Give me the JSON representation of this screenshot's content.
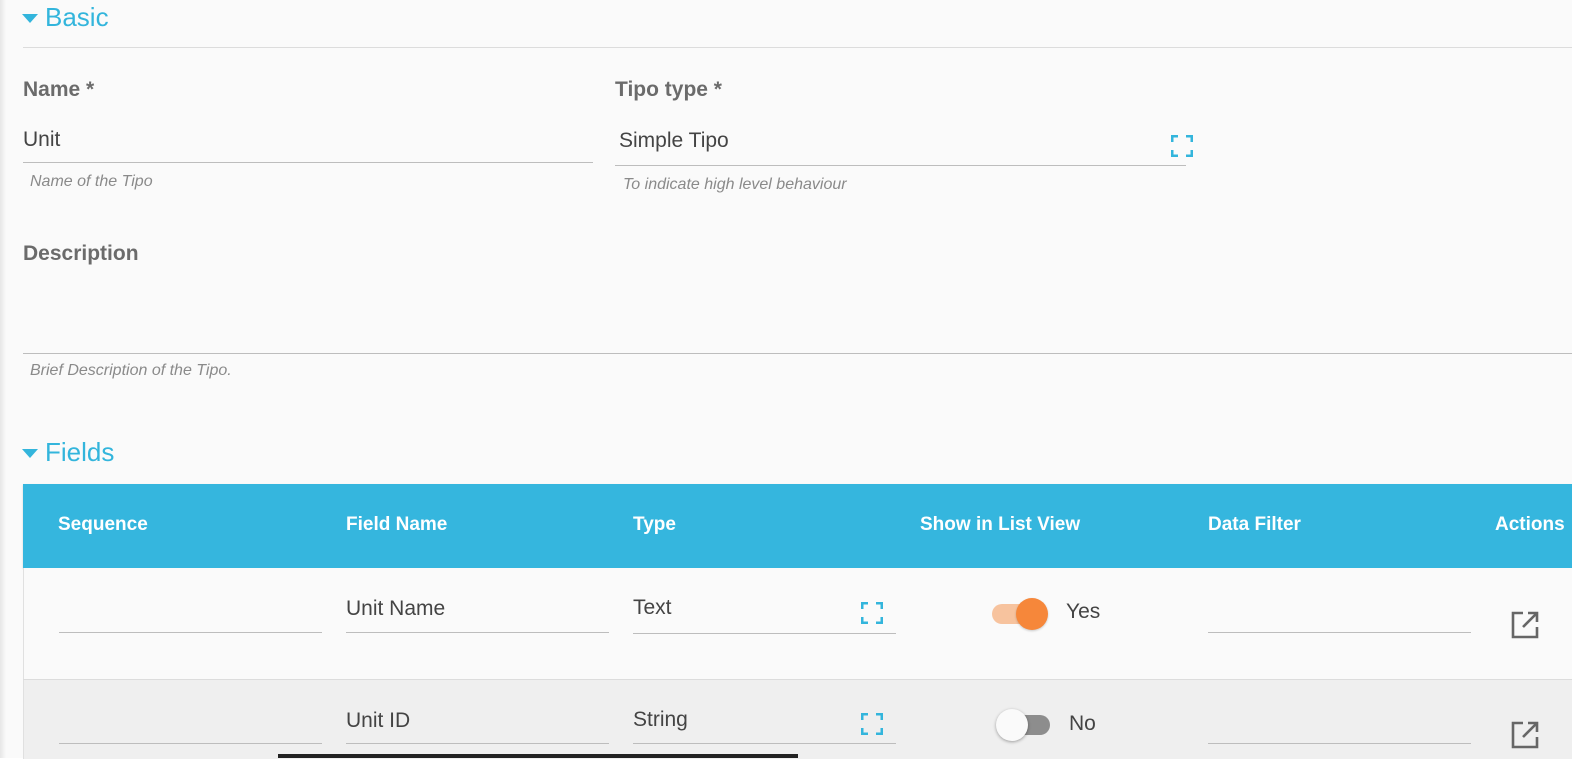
{
  "basic": {
    "section_title": "Basic",
    "name_label": "Name *",
    "name_value": "Unit",
    "name_hint": "Name of the Tipo",
    "tipo_type_label": "Tipo type *",
    "tipo_type_value": "Simple Tipo",
    "tipo_type_hint": "To indicate high level behaviour",
    "description_label": "Description",
    "description_value": "",
    "description_hint": "Brief Description of the Tipo."
  },
  "fields": {
    "section_title": "Fields",
    "columns": [
      "Sequence",
      "Field Name",
      "Type",
      "Show in List View",
      "Data Filter",
      "Actions"
    ],
    "rows": [
      {
        "sequence": "",
        "field_name": "Unit Name",
        "type": "Text",
        "show_in_list_view": true,
        "show_label": "Yes",
        "data_filter": ""
      },
      {
        "sequence": "",
        "field_name": "Unit ID",
        "type": "String",
        "show_in_list_view": false,
        "show_label": "No",
        "data_filter": ""
      }
    ]
  },
  "colors": {
    "accent": "#33b5dc",
    "table_header": "#35b6de",
    "toggle_on": "#f6873a",
    "toggle_on_track": "#f7c39e",
    "toggle_off_track": "#8d8d8d"
  },
  "icons": {
    "section_toggle": "caret-down-icon",
    "lookup": "expand-brackets-icon",
    "open": "open-in-new-icon"
  }
}
